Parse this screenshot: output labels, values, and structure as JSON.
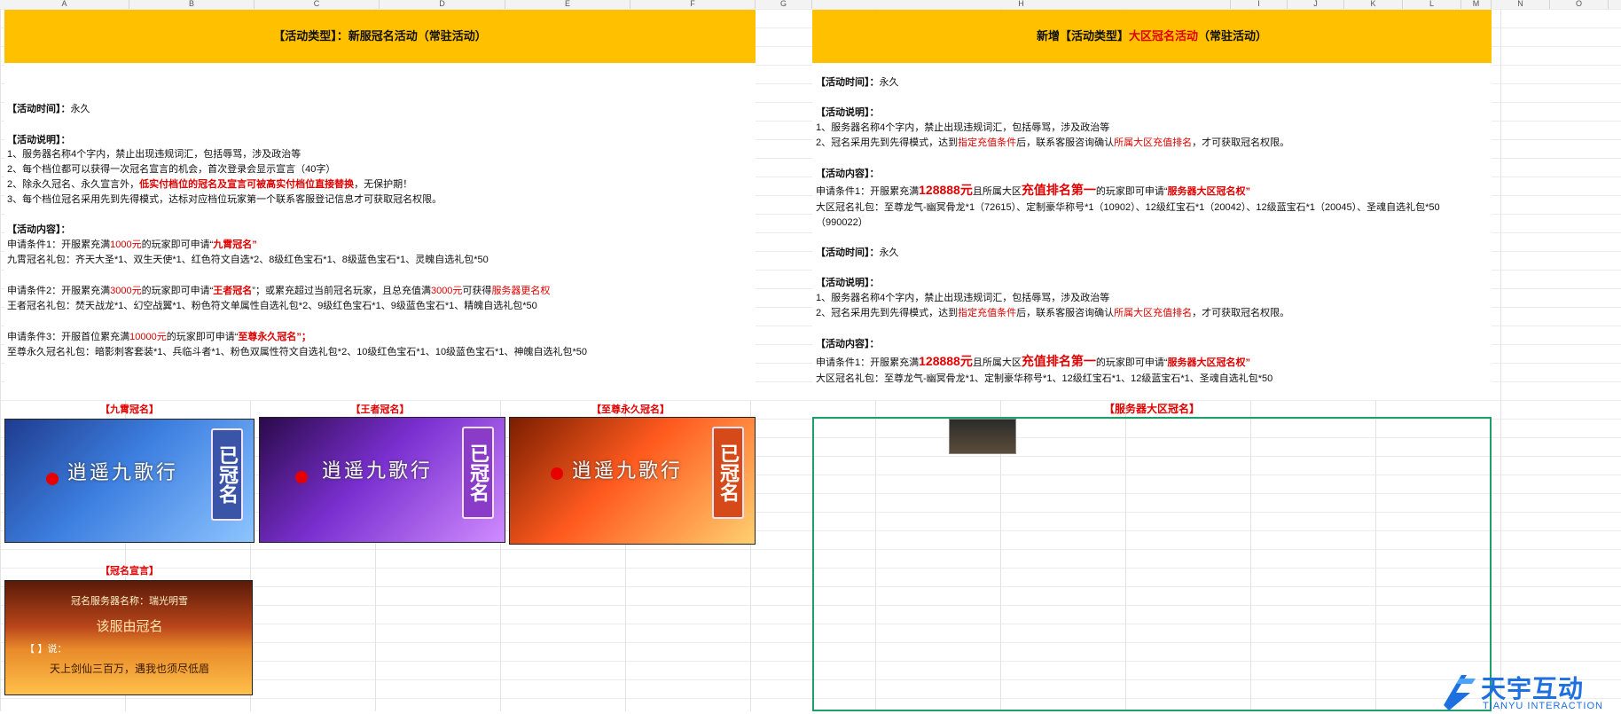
{
  "columns": [
    "A",
    "B",
    "C",
    "D",
    "E",
    "F",
    "G",
    "H",
    "I",
    "J",
    "K",
    "L",
    "M",
    "N",
    "O"
  ],
  "left": {
    "banner": {
      "prefix": "【活动类型】：新服冠名活动（常驻活动）"
    },
    "time_label": "【活动时间】：",
    "time_value": "永久",
    "desc_label": "【活动说明】：",
    "desc": [
      "1、服务器名称4个字内，禁止出现违规词汇，包括辱骂，涉及政治等",
      "2、每个档位都可以获得一次冠名宣言的机会，首次登录会显示宣言（40字）"
    ],
    "desc3_a": "2、除永久冠名、永久宣言外，",
    "desc3_b": "低实付档位的冠名及宣言可被高实付档位直接替换",
    "desc3_c": "，无保护期！",
    "desc4": "3、每个档位冠名采用先到先得模式，达标对应档位玩家第一个联系客服登记信息才可获取冠名权限。",
    "content_label": "【活动内容】：",
    "c1_a": "申请条件1：开服累充满",
    "c1_b": "1000元",
    "c1_c": "的玩家即可申请“",
    "c1_d": "九霄冠名",
    "c1_e": "”",
    "c1_gift": "九霄冠名礼包：齐天大圣*1、双生天使*1、红色符文自选*2、8级红色宝石*1、8级蓝色宝石*1、灵魄自选礼包*50",
    "c2_a": "申请条件2：开服累充满",
    "c2_b": "3000元",
    "c2_c": "的玩家即可申请“",
    "c2_d": "王者冠名",
    "c2_e": "”；或累充超过当前冠名玩家，且总充值满",
    "c2_f": "3000元",
    "c2_g": "可获得",
    "c2_h": "服务器更名权",
    "c2_gift": "王者冠名礼包：焚天战龙*1、幻空战翼*1、粉色符文单属性自选礼包*2、9级红色宝石*1、9级蓝色宝石*1、精魄自选礼包*50",
    "c3_a": "申请条件3：开服首位累充满",
    "c3_b": "10000元",
    "c3_c": "的玩家即可申请“",
    "c3_d": "至尊永久冠名",
    "c3_e": "”；",
    "c3_gift": "至尊永久冠名礼包：暗影刺客套装*1、兵临斗者*1、粉色双属性符文自选礼包*2、10级红色宝石*1、10级蓝色宝石*1、神魄自选礼包*50",
    "img_labels": [
      "【九霄冠名】",
      "【王者冠名】",
      "【至尊永久冠名】",
      "【冠名宣言】"
    ],
    "card_title": "逍遥九歌行",
    "card_tag": "已冠名",
    "decl_line1": "冠名服务器名称：瑞光明雪",
    "decl_line2": "该服由冠名",
    "decl_line3": "【  】说：",
    "decl_line4": "天上剑仙三百万，遇我也须尽低眉"
  },
  "right": {
    "banner_a": "新增【活动类型】",
    "banner_b": "大区冠名活动",
    "banner_c": "（常驻活动）",
    "blocks": [
      {
        "time_label": "【活动时间】：",
        "time_value": "永久",
        "desc_label": "【活动说明】：",
        "d1": "1、服务器名称4个字内，禁止出现违规词汇，包括辱骂，涉及政治等",
        "d2_a": "2、冠名采用先到先得模式，达到",
        "d2_b": "指定充值条件",
        "d2_c": "后，联系客服咨询确认",
        "d2_d": "所属大区充值排名",
        "d2_e": "，才可获取冠名权限。",
        "content_label": "【活动内容】：",
        "c_a": "申请条件1：开服累充满",
        "c_b": "128888元",
        "c_c": "且所属大区",
        "c_d": "充值排名第一",
        "c_e": "的玩家即可申请“",
        "c_f": "服务器大区冠名权",
        "c_g": "”",
        "gift": "大区冠名礼包：至尊龙气-幽冥骨龙*1（72615）、定制豪华称号*1（10902）、12级红宝石*1（20042）、12级蓝宝石*1（20045）、圣魂自选礼包*50",
        "gift2": "（990022）"
      },
      {
        "time_label": "【活动时间】：",
        "time_value": "永久",
        "desc_label": "【活动说明】：",
        "d1": "1、服务器名称4个字内，禁止出现违规词汇，包括辱骂，涉及政治等",
        "d2_a": "2、冠名采用先到先得模式，达到",
        "d2_b": "指定充值条件",
        "d2_c": "后，联系客服咨询确认",
        "d2_d": "所属大区充值排名",
        "d2_e": "，才可获取冠名权限。",
        "content_label": "【活动内容】：",
        "c_a": "申请条件1：开服累充满",
        "c_b": "128888元",
        "c_c": "且所属大区",
        "c_d": "充值排名第一",
        "c_e": "的玩家即可申请“",
        "c_f": "服务器大区冠名权",
        "c_g": "”",
        "gift": "大区冠名礼包：至尊龙气-幽冥骨龙*1、定制豪华称号*1、12级红宝石*1、12级蓝宝石*1、圣魂自选礼包*50"
      }
    ],
    "img_label": "【服务器大区冠名】"
  },
  "logo": {
    "cn": "天宇互动",
    "en": "TIANYU INTERACTION"
  },
  "colors": {
    "banner": "#ffc000",
    "accent_red": "#e00000",
    "selection": "#1e9e6a"
  }
}
